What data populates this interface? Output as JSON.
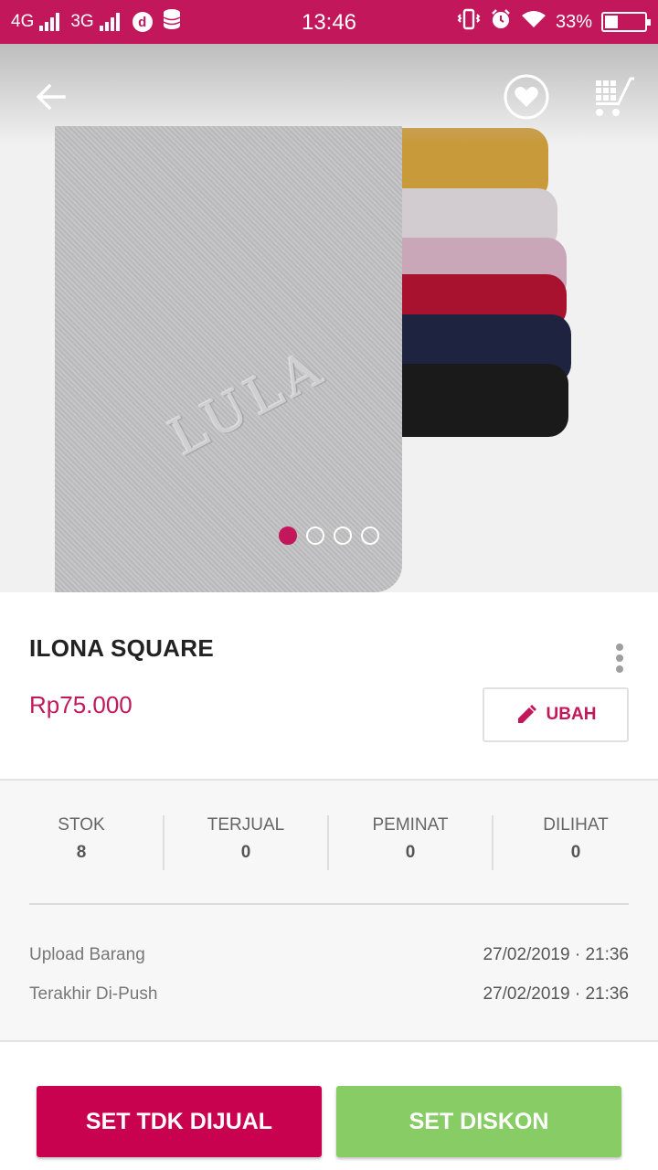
{
  "status_bar": {
    "network_1": "4G",
    "network_2": "3G",
    "d_badge": "d",
    "time": "13:46",
    "battery": "33%"
  },
  "product": {
    "image_watermark": "LULA",
    "name": "ILONA SQUARE",
    "price": "Rp75.000",
    "edit_label": "UBAH",
    "slide_count": 4,
    "active_slide": 1
  },
  "stats": [
    {
      "label": "STOK",
      "value": "8"
    },
    {
      "label": "TERJUAL",
      "value": "0"
    },
    {
      "label": "PEMINAT",
      "value": "0"
    },
    {
      "label": "DILIHAT",
      "value": "0"
    }
  ],
  "meta": {
    "upload_label": "Upload Barang",
    "upload_value": "27/02/2019 · 21:36",
    "push_label": "Terakhir Di-Push",
    "push_value": "27/02/2019 · 21:36"
  },
  "actions": {
    "unsold_label": "SET TDK DIJUAL",
    "discount_label": "SET DISKON"
  },
  "colors": {
    "brand": "#c2185b",
    "discount": "#88cc66",
    "scarf_colors": [
      "#c99a3a",
      "#c9c3c6",
      "#c9a7b9",
      "#b0112b",
      "#1e2440",
      "#1a1a1a"
    ]
  },
  "icons": [
    "back-arrow-icon",
    "heart-icon",
    "cart-icon",
    "pencil-icon",
    "more-vertical-icon"
  ]
}
